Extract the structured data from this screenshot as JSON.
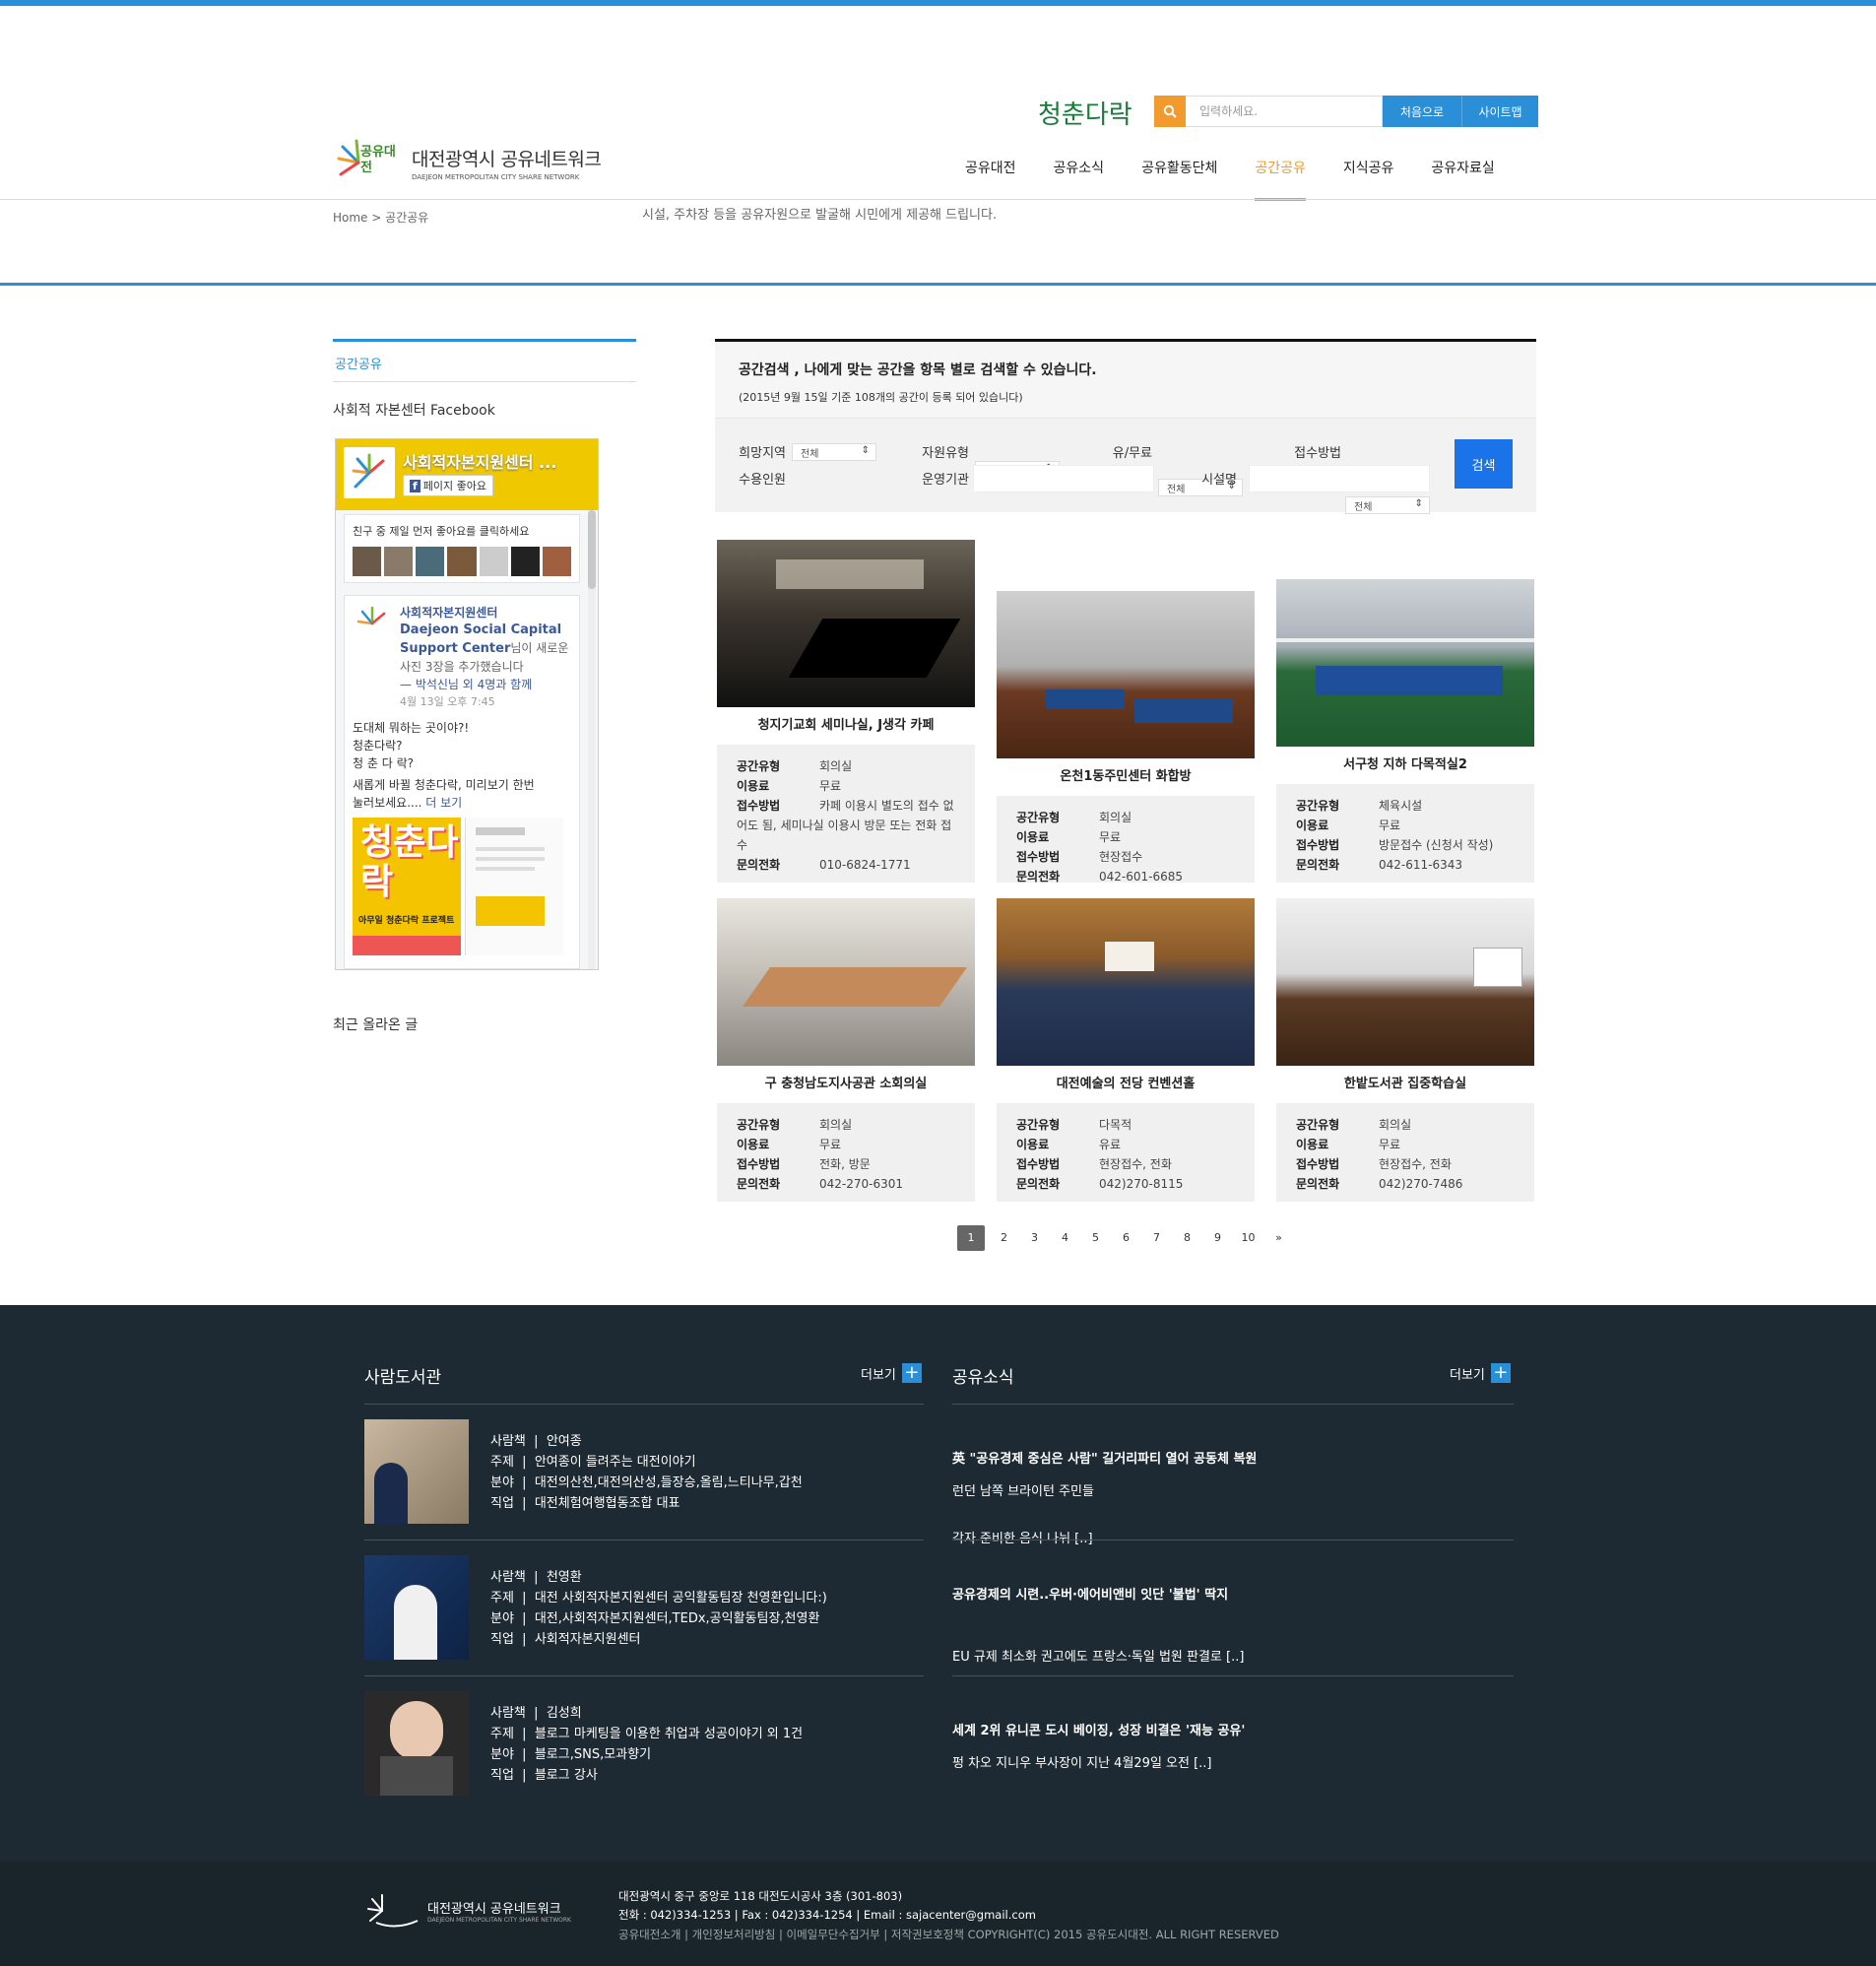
{
  "header": {
    "logo_ko": "대전광역시 공유네트워크",
    "logo_en": "DAEJEON METROPOLITAN CITY SHARE NETWORK",
    "logo_mark": "공유대전",
    "brand2": "청춘다락",
    "search_placeholder": "입력하세요.",
    "btn_home": "처음으로",
    "btn_sitemap": "사이트맵",
    "nav": [
      "공유대전",
      "공유소식",
      "공유활동단체",
      "공간공유",
      "지식공유",
      "공유자료실"
    ],
    "active_nav": "공간공유"
  },
  "breadcrumb": {
    "home": "Home",
    "sep": ">",
    "current": "공간공유"
  },
  "page_desc": "시설, 주차장 등을 공유자원으로 발굴해 시민에게 제공해 드립니다.",
  "sidebar": {
    "tab": "공간공유",
    "fb_title": "사회적 자본센터 Facebook",
    "fb": {
      "page_name": "사회적자본지원센터 ...",
      "like": "페이지 좋아요",
      "friends": "친구 중 제일 먼저 좋아요를 클릭하세요",
      "post_author_1": "사회적자본지원센터",
      "post_author_2": "Daejeon Social Capital",
      "post_author_3": "Support Center",
      "post_action": "님이 새로운 사진 3장을 추가했습니다",
      "post_with": "— 박석신님 외 4명과 함께",
      "post_time": "4월 13일 오후 7:45",
      "post_l1": "도대체 뭐하는 곳이야?!",
      "post_l2": "청춘다락?",
      "post_l3": "청 춘 다 락?",
      "post_l4": "새롭게 바뀔 청춘다락, 미리보기 한번",
      "post_l5": "눌러보세요.... ",
      "more": "더 보기",
      "poster_big": "청춘다락",
      "poster_sub": "아무일 청춘다락 프로젝트"
    },
    "recent": "최근 올라온 글"
  },
  "search_panel": {
    "title": "공간검색 , 나에게 맞는 공간을 항목 별로 검색할 수 있습니다.",
    "sub": "(2015년 9월 15일 기준 108개의 공간이 등록 되어 있습니다)",
    "labels": {
      "region": "희망지역",
      "type": "자원유형",
      "fee": "유/무료",
      "method": "접수방법",
      "capacity": "수용인원",
      "org": "운영기관",
      "facility": "시설명"
    },
    "default": "전체",
    "button": "검색"
  },
  "field_labels": {
    "type": "공간유형",
    "fee": "이용료",
    "method": "접수방법",
    "phone": "문의전화"
  },
  "spaces": [
    {
      "title": "청지기교회 세미나실, J생각 카페",
      "type": "회의실",
      "fee": "무료",
      "method": "카페 이용시 별도의 접수 없어도 됨, 세미나실 이용시 방문 또는 전화 접수",
      "phone": "010-6824-1771"
    },
    {
      "title": "온천1동주민센터 화합방",
      "type": "회의실",
      "fee": "무료",
      "method": "현장접수",
      "phone": "042-601-6685"
    },
    {
      "title": "서구청 지하 다목적실2",
      "type": "체육시설",
      "fee": "무료",
      "method": "방문접수 (신청서 작성)",
      "phone": "042-611-6343"
    },
    {
      "title": "구 충청남도지사공관 소회의실",
      "type": "회의실",
      "fee": "무료",
      "method": "전화, 방문",
      "phone": "042-270-6301"
    },
    {
      "title": "대전예술의 전당 컨벤션홀",
      "type": "다목적",
      "fee": "유료",
      "method": "현장접수, 전화",
      "phone": "042)270-8115"
    },
    {
      "title": "한밭도서관 집중학습실",
      "type": "회의실",
      "fee": "무료",
      "method": "현장접수, 전화",
      "phone": "042)270-7486"
    }
  ],
  "pagination": [
    "1",
    "2",
    "3",
    "4",
    "5",
    "6",
    "7",
    "8",
    "9",
    "10",
    "»"
  ],
  "library": {
    "title": "사람도서관",
    "more": "더보기",
    "labels": {
      "book": "사람책",
      "topic": "주제",
      "field": "분야",
      "job": "직업"
    },
    "people": [
      {
        "book": "안여종",
        "topic": "안여종이 들려주는 대전이야기",
        "field": "대전의산천,대전의산성,들장승,올림,느티나무,갑천",
        "job": "대전체험여행협동조합 대표"
      },
      {
        "book": "천영환",
        "topic": "대전 사회적자본지원센터 공익활동팀장 천영환입니다:)",
        "field": "대전,사회적자본지원센터,TEDx,공익활동팀장,천영환",
        "job": "사회적자본지원센터"
      },
      {
        "book": "김성희",
        "topic": "블로그 마케팅을 이용한 취업과 성공이야기 외 1건",
        "field": "블로그,SNS,모과향기",
        "job": "블로그 강사"
      }
    ]
  },
  "news": {
    "title": "공유소식",
    "more": "더보기",
    "items": [
      {
        "title": "英 \"공유경제 중심은 사람\" 길거리파티 열어 공동체 복원",
        "d1": "런던 남쪽 브라이턴 주민들",
        "d2": "각자 준비한 음식 나눠 [..]"
      },
      {
        "title": "공유경제의 시련..우버·에어비앤비 잇단 '불법' 딱지",
        "d1": "EU 규제 최소화 권고에도 프랑스·독일 법원 판결로 [..]"
      },
      {
        "title": "세계 2위 유니콘 도시 베이징, 성장 비결은 '재능 공유'",
        "d1": "펑 차오 지니우 부사장이 지난 4월29일 오전 [..]"
      }
    ]
  },
  "footer": {
    "addr": "대전광역시 중구 중앙로 118 대전도시공사 3층 (301-803)",
    "contact": "전화 : 042)334-1253 | Fax : 042)334-1254 | Email : sajacenter@gmail.com",
    "links": "공유대전소개 | 개인정보처리방침 | 이메일무단수집거부 | 저작권보호정책 COPYRIGHT(C) 2015 공유도시대전. ALL RIGHT RESERVED"
  },
  "colors": {
    "accent": "#2b8fd8",
    "orange": "#f39a2c",
    "dark": "#1d2a33",
    "button": "#1a73e8"
  }
}
